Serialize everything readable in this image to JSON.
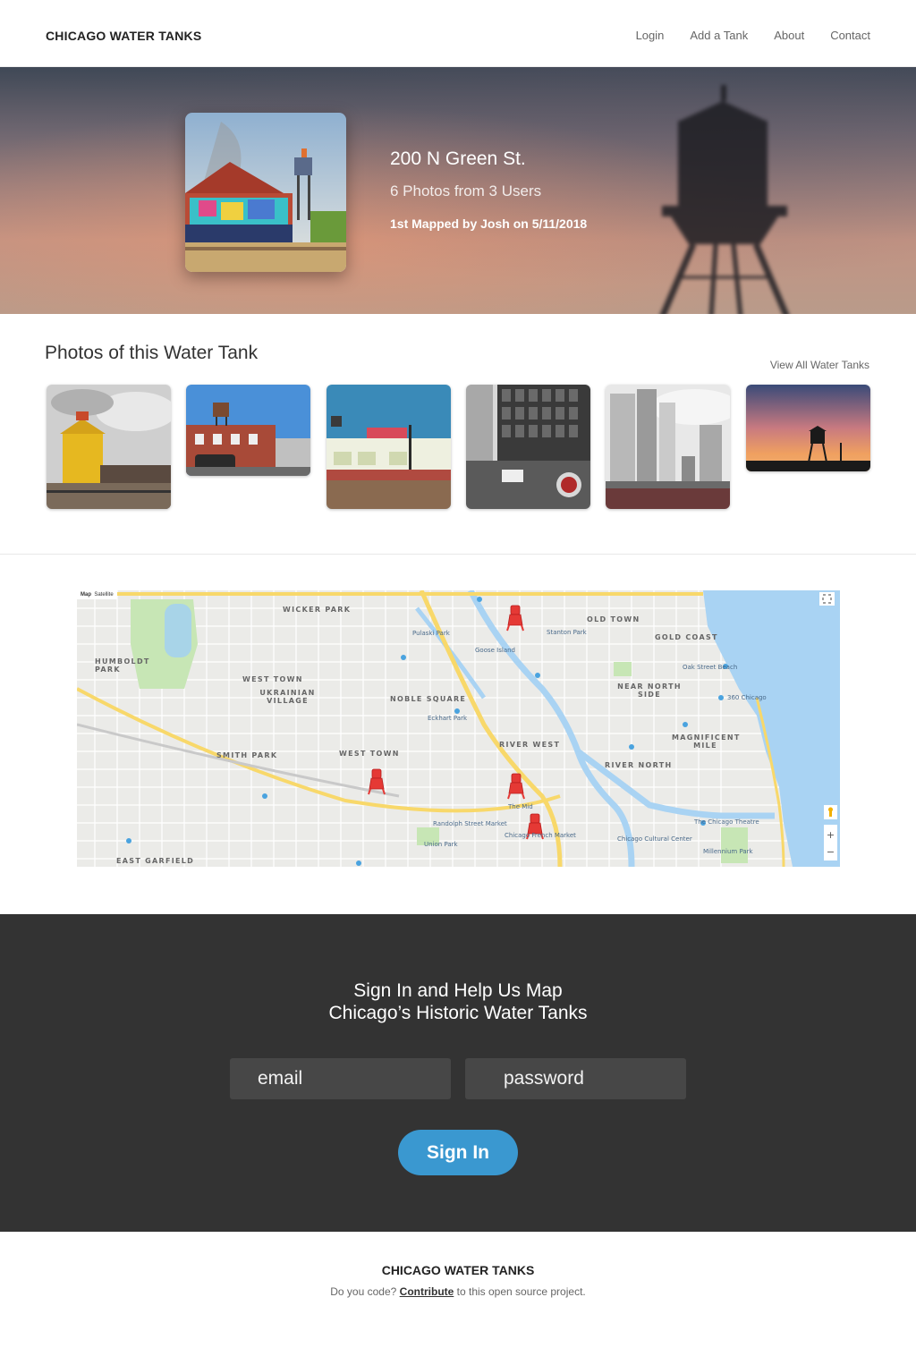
{
  "nav": {
    "brand": "CHICAGO WATER TANKS",
    "links": [
      "Login",
      "Add a Tank",
      "About",
      "Contact"
    ]
  },
  "hero": {
    "address": "200 N Green St.",
    "photo_summary": "6 Photos from 3 Users",
    "mapped_by": "1st Mapped by Josh on 5/11/2018"
  },
  "photos": {
    "title": "Photos of  this Water Tank",
    "view_all": "View All Water Tanks"
  },
  "map": {
    "tabs": [
      "Map",
      "Satellite"
    ],
    "neighborhoods": [
      "WICKER PARK",
      "OLD TOWN",
      "GOLD COAST",
      "HUMBOLDT PARK",
      "WEST TOWN",
      "UKRAINIAN VILLAGE",
      "NOBLE SQUARE",
      "NEAR NORTH SIDE",
      "RIVER WEST",
      "MAGNIFICENT MILE",
      "SMITH PARK",
      "WEST TOWN",
      "RIVER NORTH",
      "EAST GARFIELD"
    ],
    "places": [
      "Pulaski Park",
      "Goose Island",
      "Stanton Park",
      "Oak Street Beach",
      "360 Chicago",
      "Eckhart Park",
      "The Mid",
      "Randolph Street Market",
      "Union Park",
      "Chicago French Market",
      "Chicago Cultural Center",
      "The Chicago Theatre",
      "Millennium Park"
    ],
    "marker_count": 4
  },
  "signin": {
    "title_line1": "Sign In and Help Us Map",
    "title_line2": "Chicago’s Historic Water Tanks",
    "email_placeholder": "email",
    "password_placeholder": "password",
    "button": "Sign In"
  },
  "footer": {
    "brand": "CHICAGO WATER TANKS",
    "text_before": "Do you code?",
    "link": "Contribute",
    "text_after": "to this open source project."
  },
  "colors": {
    "accent": "#3a98d0",
    "dark_section": "#333333",
    "marker": "#e53935"
  }
}
